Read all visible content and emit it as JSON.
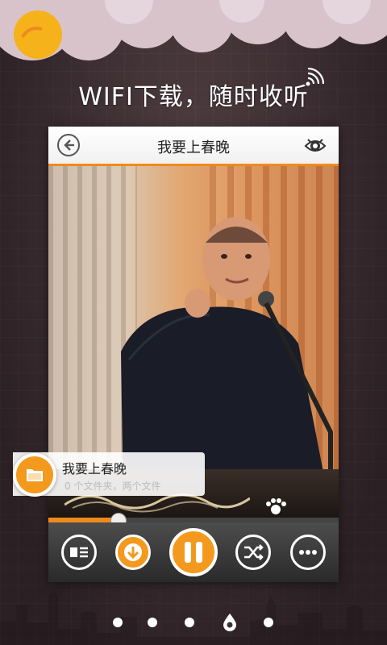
{
  "headline": "WIFI下载，随时收听",
  "player": {
    "title": "我要上春晚",
    "progress": 0.24
  },
  "song_card": {
    "title": "我要上春晚",
    "subtitle": "0 个文件夹，两个文件"
  },
  "controls": [
    "playlist",
    "download",
    "pause",
    "shuffle",
    "more"
  ],
  "pagination": {
    "count": 5,
    "active_index": 3
  },
  "colors": {
    "accent": "#f39a1e",
    "background": "#3f3236"
  }
}
